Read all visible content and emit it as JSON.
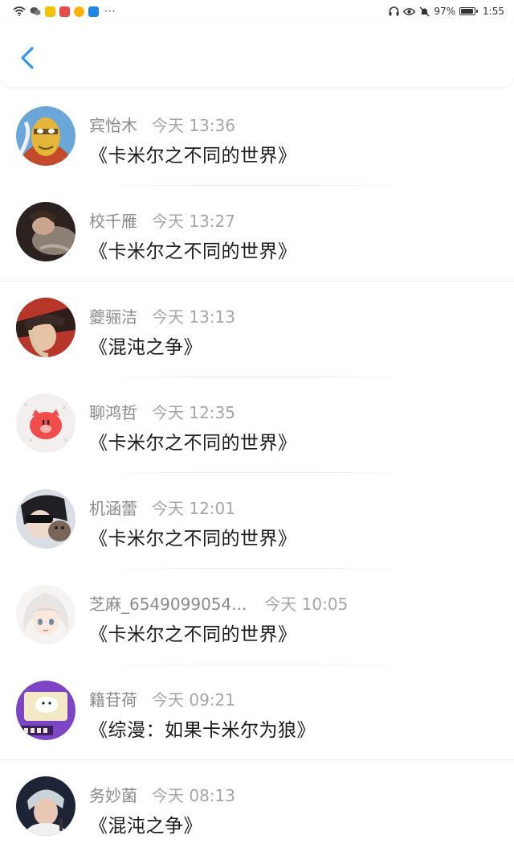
{
  "status_bar": {
    "battery": "97%",
    "time": "1:55",
    "more": "···"
  },
  "header": {
    "back_icon": "chevron-left-icon",
    "accent_color": "#2f9be6"
  },
  "messages": [
    {
      "name": "宾怡木",
      "time": "今天 13:36",
      "title": "《卡米尔之不同的世界》"
    },
    {
      "name": "校千雁",
      "time": "今天 13:27",
      "title": "《卡米尔之不同的世界》"
    },
    {
      "name": "夔骊洁",
      "time": "今天 13:13",
      "title": "《混沌之争》"
    },
    {
      "name": "聊鸿哲",
      "time": "今天 12:35",
      "title": "《卡米尔之不同的世界》"
    },
    {
      "name": "机涵蕾",
      "time": "今天 12:01",
      "title": "《卡米尔之不同的世界》"
    },
    {
      "name": "芝麻_6549099054...",
      "time": "今天 10:05",
      "title": "《卡米尔之不同的世界》"
    },
    {
      "name": "籍苷荷",
      "time": "今天 09:21",
      "title": "《综漫：如果卡米尔为狼》"
    },
    {
      "name": "务妙菌",
      "time": "今天 08:13",
      "title": "《混沌之争》"
    }
  ]
}
